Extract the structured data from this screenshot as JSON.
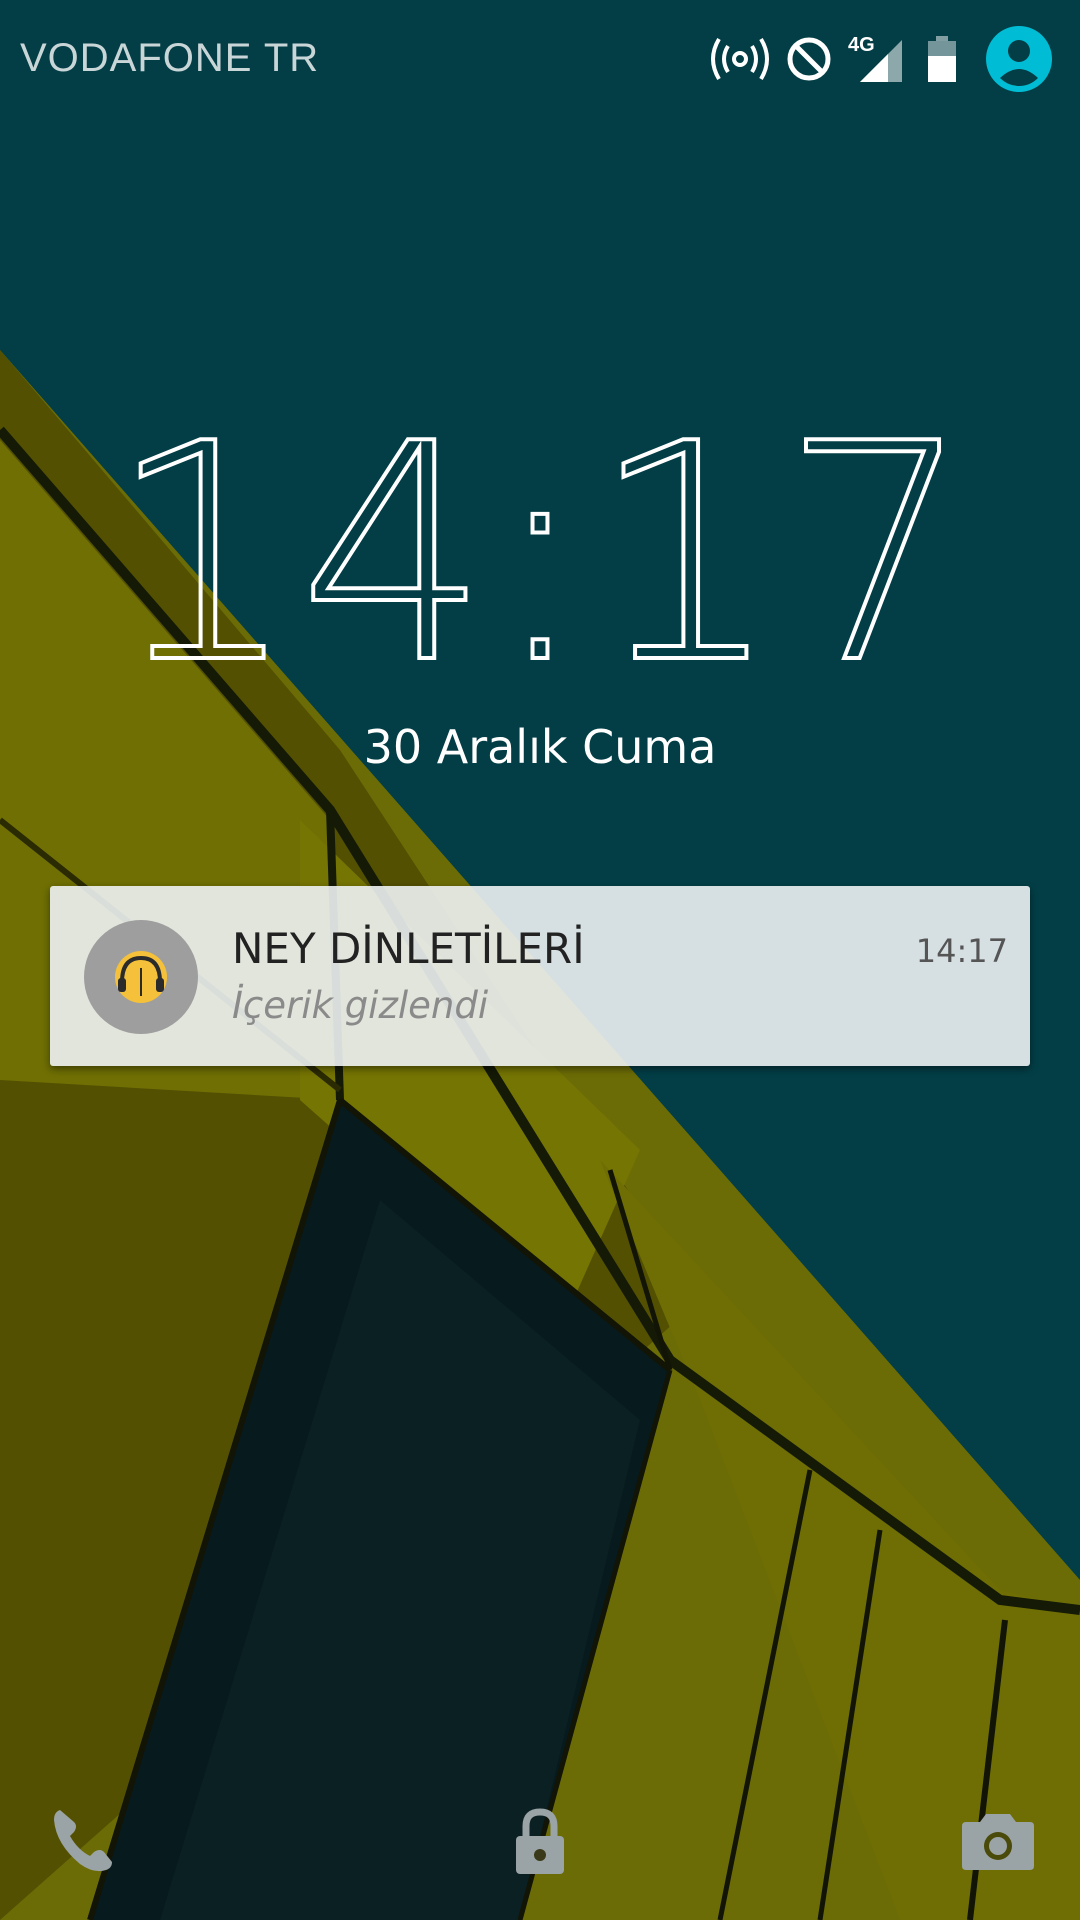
{
  "status_bar": {
    "carrier": "VODAFONE TR",
    "network_type": "4G",
    "icons": [
      "hotspot-icon",
      "do-not-disturb-icon",
      "signal-icon",
      "battery-icon",
      "user-avatar-icon"
    ]
  },
  "clock": {
    "time": "14:17",
    "date": "30 Aralık Cuma"
  },
  "notification": {
    "app_icon": "ney-dinletileri-app-icon",
    "title": "NEY DİNLETİLERİ",
    "text": "İçerik gizlendi",
    "time": "14:17"
  },
  "bottom_actions": [
    "phone-icon",
    "lock-icon",
    "camera-icon"
  ],
  "colors": {
    "background": "#033e46",
    "wallpaper_yellow": "#7a7a06",
    "accent_avatar": "#00bcd4",
    "notification_bg": "#edf2f3"
  }
}
